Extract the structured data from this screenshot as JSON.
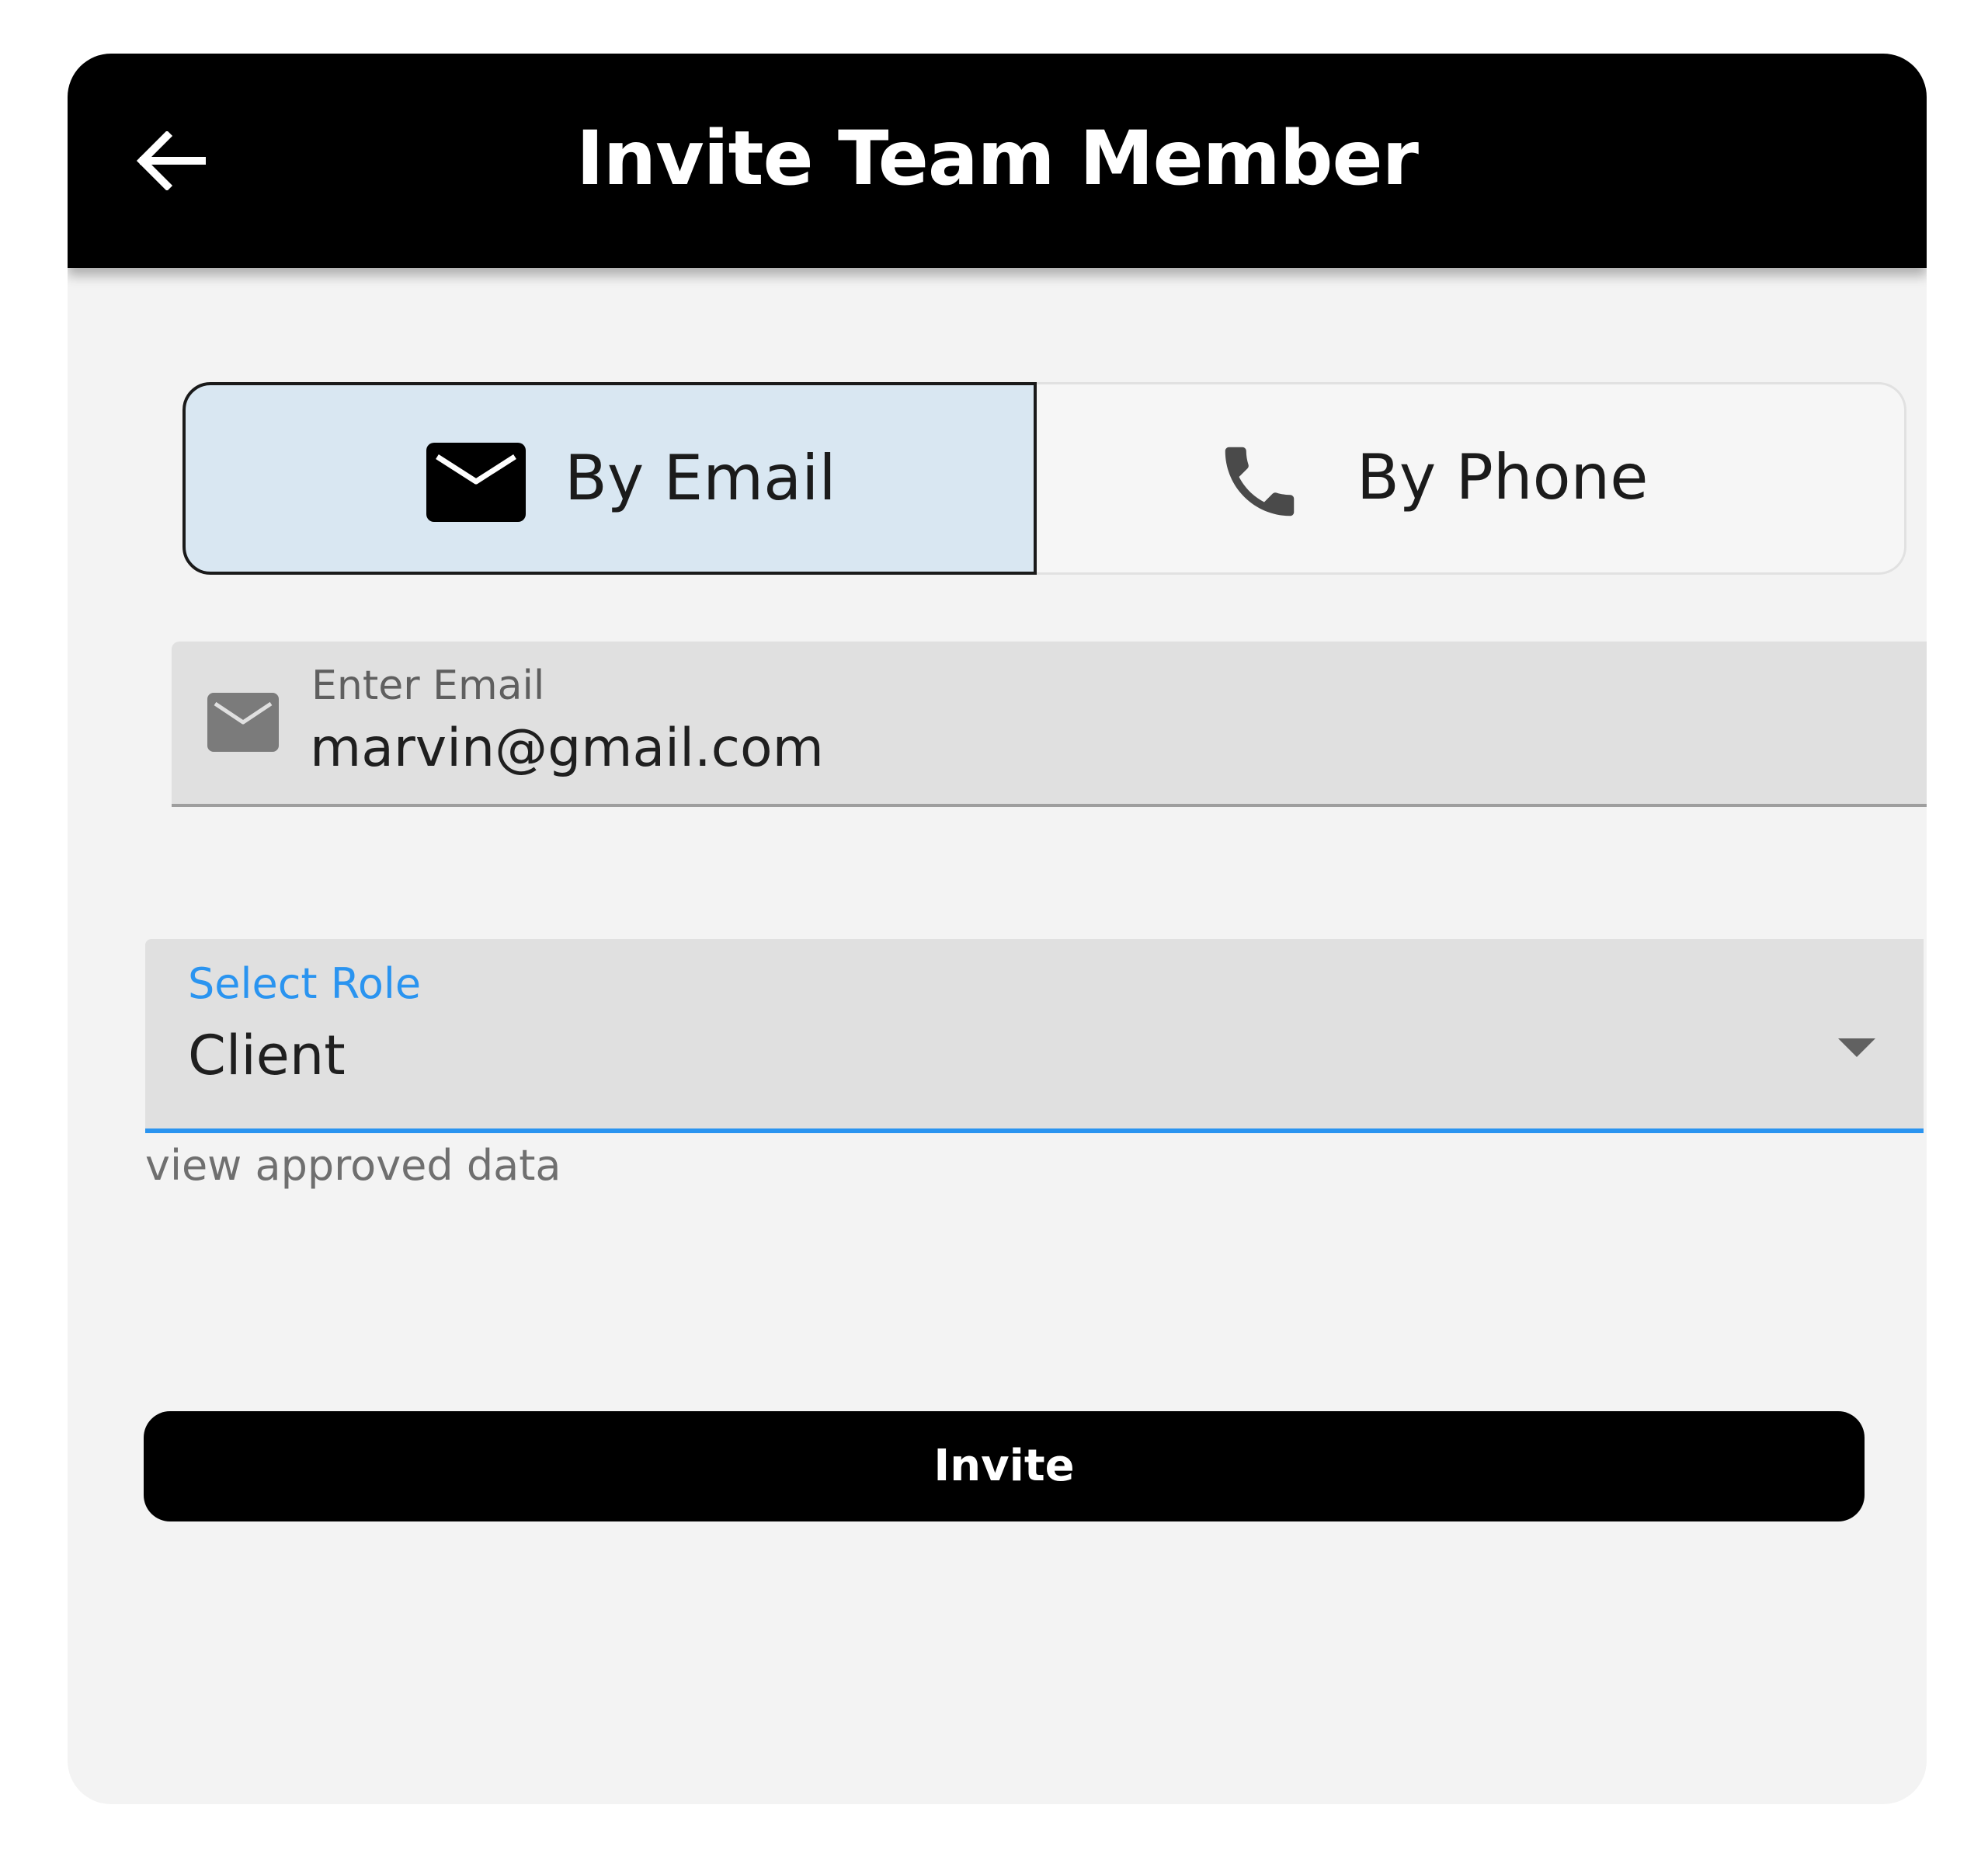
{
  "header": {
    "title": "Invite Team Member",
    "back_icon": "arrow-left-icon"
  },
  "invite_method": {
    "options": [
      {
        "label": "By Email",
        "icon": "mail-icon",
        "selected": true
      },
      {
        "label": "By Phone",
        "icon": "phone-icon",
        "selected": false
      }
    ]
  },
  "email_field": {
    "label": "Enter Email",
    "value": "marvin@gmail.com",
    "icon": "mail-icon"
  },
  "role_field": {
    "label": "Select Role",
    "value": "Client",
    "helper": "view approved data",
    "icon": "dropdown-arrow-icon"
  },
  "actions": {
    "invite_label": "Invite"
  },
  "colors": {
    "appbar": "#000000",
    "background": "#f3f3f3",
    "selected_segment": "#d9e7f2",
    "accent": "#2a94f0",
    "button": "#000000"
  }
}
